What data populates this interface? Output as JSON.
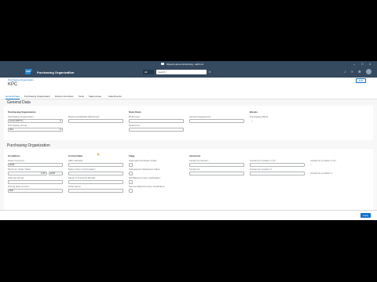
{
  "window": {
    "title": "Myweb Home Accounting - Edit Ltd",
    "controls": [
      "–",
      "□",
      "×"
    ]
  },
  "shell": {
    "logo": "SAP",
    "app_title": "Purchasing Organization",
    "scope": "All",
    "search_placeholder": "Search",
    "icons": [
      "search-icon",
      "bell-icon",
      "help-icon",
      "settings-icon"
    ]
  },
  "header": {
    "breadcrumb": "Purchasing Organization",
    "title": "KPC",
    "edit_label": "Edit"
  },
  "tabs": [
    {
      "label": "General Data",
      "active": true
    },
    {
      "label": "Purchasing Organization",
      "active": false
    },
    {
      "label": "Partner Functions",
      "active": false
    },
    {
      "label": "Texts",
      "active": false
    },
    {
      "label": "Sales Areas",
      "active": false
    },
    {
      "label": "Attachments",
      "active": false
    }
  ],
  "general_data": {
    "section_title": "General Data",
    "groups": {
      "purchasing_org": {
        "title": "Purchasing Organization",
        "org_label": "Purchasing Organization:",
        "org_value": "1010 (MKT1)",
        "group_label": "Purchasing Group:",
        "group_value": "001"
      },
      "center": {
        "ref_label": "Reference/Default Plant/Cost:"
      },
      "data_claim": {
        "title": "Data Claim",
        "f1_label": "Reference:",
        "f2_label": "Reference:"
      },
      "other": {
        "f1_label": "Account Assignment:"
      },
      "blocks": {
        "title": "Blocks",
        "f1_label": "Purchasing Block:",
        "f1_value": "–"
      }
    }
  },
  "purchasing_org_section": {
    "section_title": "Purchasing Organization",
    "conditions": {
      "title": "Conditions",
      "order_currency_label": "Order Currency:",
      "order_currency_value": "EUR",
      "min_order_label": "Minimum Order Value:",
      "min_order_value": "0,00",
      "min_order_unit": "EUR",
      "schema_label": "Schema Group:",
      "pricing_label": "Pricing Date Control:",
      "pricing_value": "000"
    },
    "control_data": {
      "title": "Control Data",
      "f1_label": "ABC Indicator:",
      "f2_label": "Sales Order Confirmation:",
      "f3_label": "Mode of Transport-Border:",
      "f4_label": "Order Entry:"
    },
    "flags": {
      "title": "Flags",
      "f1_label": "Automatic Purchase Order:",
      "f2_label": "Subsequent Settlement Index:",
      "f3_label": "GR-Based Invoice Verification:",
      "f4_label": "Service-Based Invoice Verification:"
    },
    "incoterms": {
      "title": "Incoterms",
      "f1_label": "Incoterms Version:",
      "f2_label": "Incoterms:",
      "f3_label": "Incoterms Location 1:"
    },
    "extra": {
      "f1_label": "Incoterms Location 1 (T):",
      "f2_label": "Incoterms Location 2:",
      "f3_label": "Incoterms Location 2 (T):",
      "f3_value": "–"
    }
  },
  "footer": {
    "apply_label": "Apply"
  }
}
